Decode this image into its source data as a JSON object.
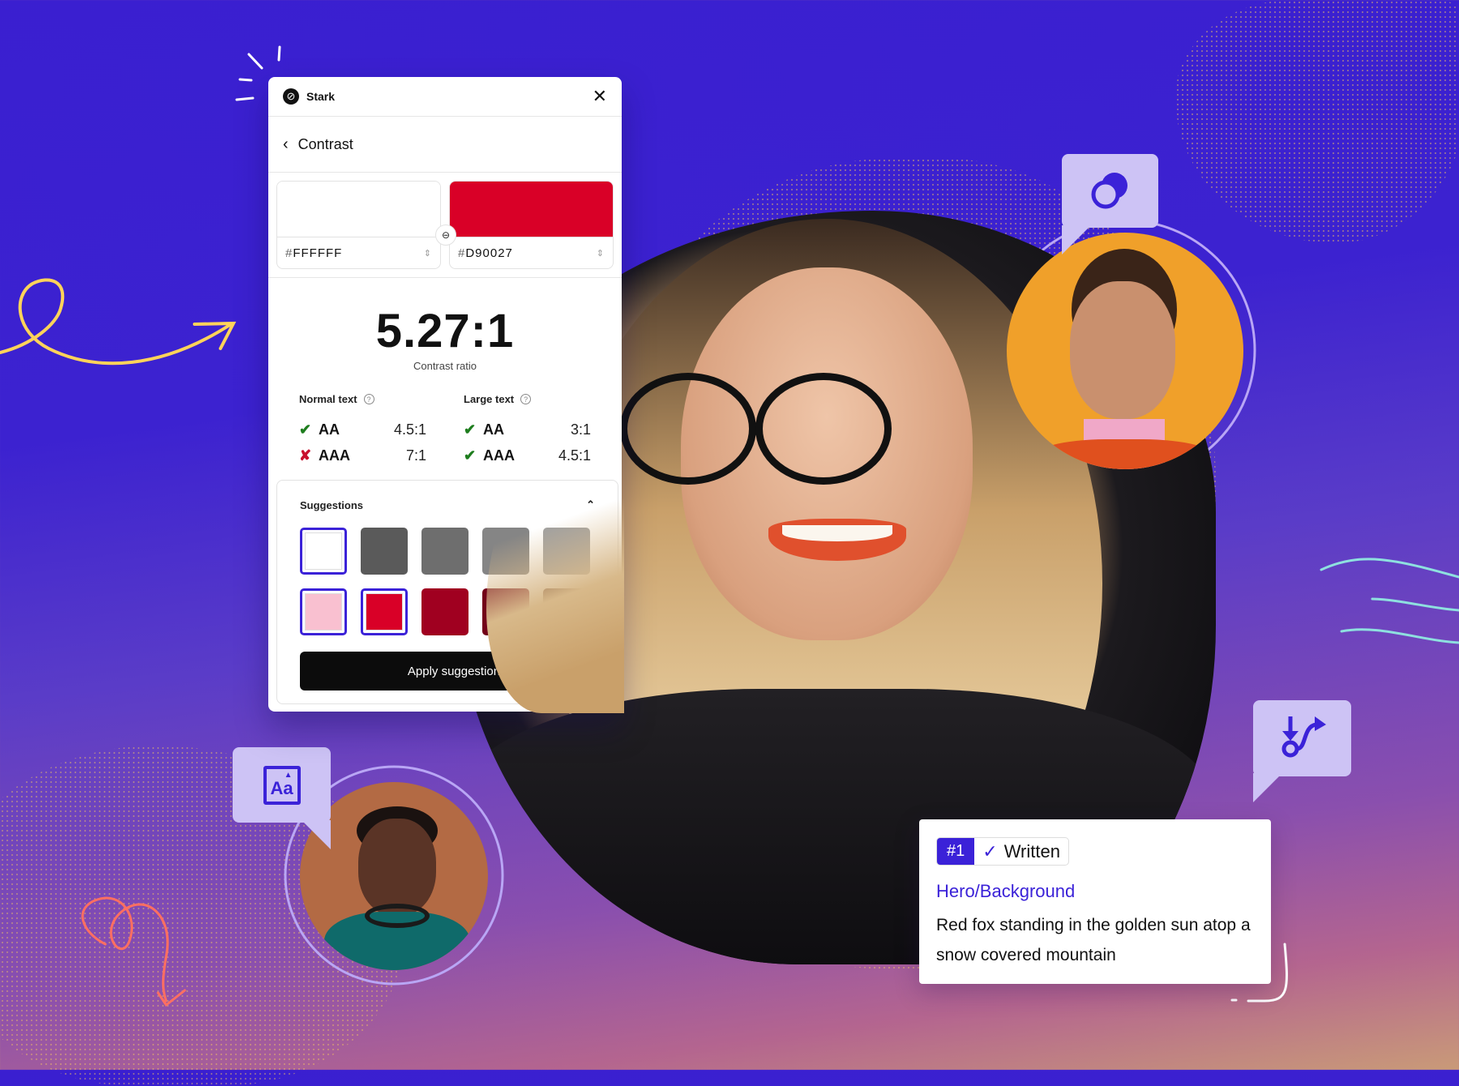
{
  "colors": {
    "brand": "#3B22D8",
    "background_top": "#3A1FD0",
    "bubble": "#CDC3F5",
    "pass": "#1E7D1E",
    "fail": "#C8102E"
  },
  "panel": {
    "app_name": "Stark",
    "logo_glyph": "⊘",
    "close_icon": "✕",
    "back_icon": "‹",
    "section_title": "Contrast",
    "foreground": {
      "hash": "#",
      "value": "FFFFFF",
      "color": "#FFFFFF"
    },
    "background": {
      "hash": "#",
      "value": "D90027",
      "color": "#D90027"
    },
    "link_icon": "⊖",
    "stepper_icon": "⇕",
    "ratio": "5.27:1",
    "ratio_label": "Contrast ratio",
    "normal_text": {
      "label": "Normal text",
      "rows": [
        {
          "level": "AA",
          "status": "pass",
          "icon": "✔",
          "requirement": "4.5:1"
        },
        {
          "level": "AAA",
          "status": "fail",
          "icon": "✘",
          "requirement": "7:1"
        }
      ]
    },
    "large_text": {
      "label": "Large text",
      "rows": [
        {
          "level": "AA",
          "status": "pass",
          "icon": "✔",
          "requirement": "3:1"
        },
        {
          "level": "AAA",
          "status": "pass",
          "icon": "✔",
          "requirement": "4.5:1"
        }
      ]
    },
    "help_icon": "?",
    "suggestions": {
      "label": "Suggestions",
      "collapse_icon": "⌃",
      "row1": [
        {
          "color": "#FFFFFF",
          "selected": true
        },
        {
          "color": "#5A5A5A",
          "selected": false
        },
        {
          "color": "#6E6E6E",
          "selected": false
        },
        {
          "color": "#858585",
          "selected": false
        },
        {
          "color": "#A0A0A0",
          "selected": false
        }
      ],
      "row2": [
        {
          "color": "#F9C0D0",
          "selected": true
        },
        {
          "color": "#D90027",
          "selected": true
        },
        {
          "color": "#A00020",
          "selected": false
        },
        {
          "color": "#720018",
          "selected": false
        },
        {
          "color": "#4A1A0C",
          "selected": false
        }
      ],
      "apply_label": "Apply suggestion"
    }
  },
  "written_card": {
    "number": "#1",
    "check_icon": "✓",
    "status": "Written",
    "layer_name": "Hero/Background",
    "alt_text": "Red fox standing in the golden sun atop a snow covered mountain"
  },
  "bubbles": {
    "top_right_icon": "overlapping-circles",
    "bottom_right_icon": "reading-order-flow",
    "left_icon_text": "Aa"
  }
}
